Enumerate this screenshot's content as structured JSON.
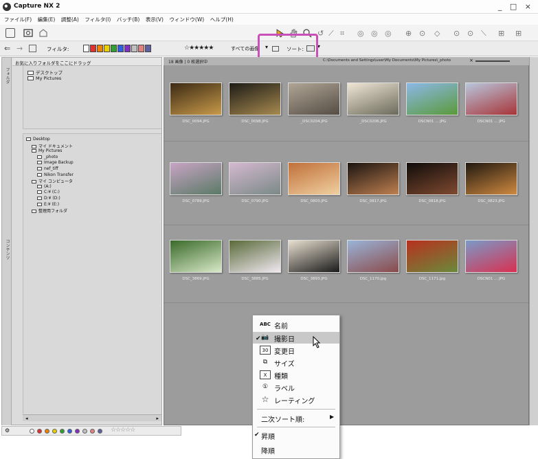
{
  "window": {
    "title": "Capture NX 2",
    "controls": "_ □ ×"
  },
  "menubar": {
    "items": [
      "ファイル(F)",
      "編集(E)",
      "調整(A)",
      "フィルタ(I)",
      "バッチ(B)",
      "表示(V)",
      "ウィンドウ(W)",
      "ヘルプ(H)"
    ]
  },
  "toolbar2": {
    "filter_label": "フィルタ:",
    "rating_filter": "☆★★★★★",
    "all_images": "すべての画像",
    "sort_label": "ソート:",
    "label_colors": [
      "#ffffff",
      "#e03030",
      "#f08000",
      "#e8d000",
      "#30a030",
      "#3060e0",
      "#8030c0",
      "#c0c0c0",
      "#e08080",
      "#6060a0"
    ]
  },
  "left_pane": {
    "favorites_tab": "フォルダ",
    "contents_tab": "コンテンツ",
    "favorites_header": "お気に入りフォルダをここにドラッグ",
    "favorites": [
      "デスクトップ",
      "My Pictures"
    ],
    "tree": [
      {
        "label": "Desktop",
        "level": 0
      },
      {
        "label": "マイ ドキュメント",
        "level": 1
      },
      {
        "label": "My Pictures",
        "level": 1
      },
      {
        "label": "_photo",
        "level": 2
      },
      {
        "label": "Image Backup",
        "level": 2
      },
      {
        "label": "nef_tiff",
        "level": 2
      },
      {
        "label": "Nikon Transfer",
        "level": 2
      },
      {
        "label": "マイ コンピュータ",
        "level": 1
      },
      {
        "label": "(A:)",
        "level": 2
      },
      {
        "label": "C:¥ (C:)",
        "level": 2
      },
      {
        "label": "D:¥ (D:)",
        "level": 2
      },
      {
        "label": "E:¥ (E:)",
        "level": 2
      },
      {
        "label": "整理用フォルダ",
        "level": 1
      }
    ]
  },
  "browser": {
    "count_text": "18 画像 | 0 枚選択中",
    "path_text": "C:\\Documents and Settings\\user\\My Documents\\My Pictures\\_photo",
    "thumbnails": [
      {
        "name": "DSC_0094.JPG",
        "colors": [
          "#3b2a14",
          "#c89a4a"
        ]
      },
      {
        "name": "DSC_0098.JPG",
        "colors": [
          "#1c1b16",
          "#a88a50"
        ]
      },
      {
        "name": "_DSC0204.JPG",
        "colors": [
          "#b0a696",
          "#554c44"
        ]
      },
      {
        "name": "_DSC0206.JPG",
        "colors": [
          "#f0e6d6",
          "#6a6a5a"
        ]
      },
      {
        "name": "DSCN01 ... JPG",
        "colors": [
          "#8cb8e8",
          "#5a9a3a"
        ]
      },
      {
        "name": "DSCN01 ... JPG",
        "colors": [
          "#b8c6dc",
          "#a83438"
        ]
      },
      {
        "name": "DSC_0789.JPG",
        "colors": [
          "#c8a4c4",
          "#5a7a66"
        ]
      },
      {
        "name": "DSC_0790.JPG",
        "colors": [
          "#d4b8d0",
          "#7a8a86"
        ]
      },
      {
        "name": "DSC_0803.JPG",
        "colors": [
          "#c0703a",
          "#f0d0a0"
        ]
      },
      {
        "name": "DSC_0817.JPG",
        "colors": [
          "#1a1410",
          "#c08050"
        ]
      },
      {
        "name": "DSC_0818.JPG",
        "colors": [
          "#100c0a",
          "#804a30"
        ]
      },
      {
        "name": "DSC_0823.JPG",
        "colors": [
          "#201810",
          "#d08a40"
        ]
      },
      {
        "name": "DSC_3869.JPG",
        "colors": [
          "#3a6a2a",
          "#d8e8c8"
        ]
      },
      {
        "name": "DSC_3885.JPG",
        "colors": [
          "#5a6a3a",
          "#f0e8f0"
        ]
      },
      {
        "name": "DSC_3893.JPG",
        "colors": [
          "#e8e0d0",
          "#1a1a1a"
        ]
      },
      {
        "name": "DSC_1170.jpg",
        "colors": [
          "#9ab4d8",
          "#8a4a4a"
        ]
      },
      {
        "name": "DSC_1171.jpg",
        "colors": [
          "#b8301e",
          "#6a8a3a"
        ]
      },
      {
        "name": "DSCN01 ... JPG",
        "colors": [
          "#7a9ac8",
          "#d83050"
        ]
      }
    ]
  },
  "context_menu": {
    "items": [
      {
        "icon": "ABC",
        "label": "名前"
      },
      {
        "icon": "📷",
        "label": "撮影日"
      },
      {
        "icon": "30",
        "label": "変更日"
      },
      {
        "icon": "⧉",
        "label": "サイズ"
      },
      {
        "icon": "X",
        "label": "種類"
      },
      {
        "icon": "①",
        "label": "ラベル"
      },
      {
        "icon": "☆",
        "label": "レーティング"
      }
    ],
    "secondary_sort": "二次ソート順:",
    "ascending": "昇順",
    "descending": "降順"
  },
  "statusbar": {
    "stars": "☆☆☆☆☆"
  },
  "colors": {
    "highlight": "#c850b8"
  }
}
